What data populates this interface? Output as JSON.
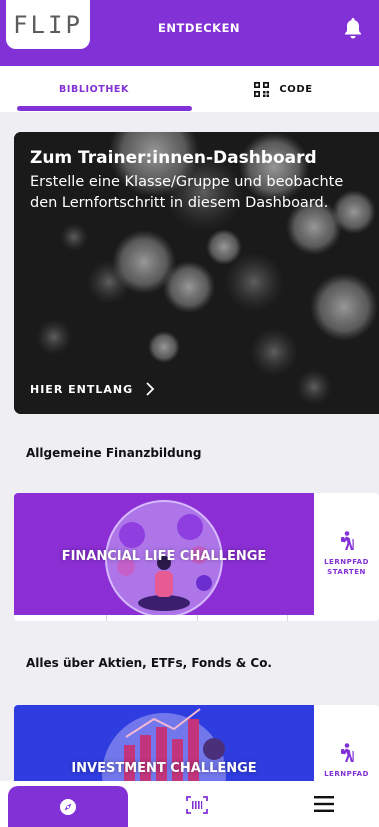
{
  "header": {
    "logo": "FLIP",
    "title": "ENTDECKEN",
    "bell_icon": "bell-icon",
    "accent": "#8231d6"
  },
  "tabs": [
    {
      "label": "BIBLIOTHEK",
      "active": true
    },
    {
      "label": "CODE",
      "icon": "qr-code-icon",
      "active": false
    }
  ],
  "hero": {
    "title": "Zum Trainer:innen-Dashboard",
    "text": "Erstelle eine Klasse/Gruppe und beobachte den Lernfortschritt in diesem Dashboard.",
    "cta": "HIER ENTLANG"
  },
  "sections": [
    {
      "title": "Allgemeine Finanzbildung",
      "card": {
        "title": "FINANCIAL LIFE CHALLENGE",
        "side_label": "LERNPFAD STARTEN",
        "color": "#8b2fd4"
      }
    },
    {
      "title": "Alles über Aktien, ETFs, Fonds & Co.",
      "card": {
        "title": "INVESTMENT CHALLENGE",
        "side_label": "LERNPFAD",
        "color": "#2f3de0"
      }
    }
  ],
  "bottom_nav": [
    {
      "icon": "compass-icon",
      "active": true
    },
    {
      "icon": "scan-icon",
      "active": false
    },
    {
      "icon": "menu-icon",
      "active": false
    }
  ]
}
